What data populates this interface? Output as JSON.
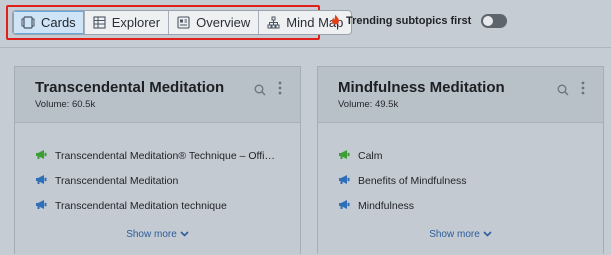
{
  "toolbar": {
    "tabs": [
      {
        "label": "Cards",
        "icon": "cards-icon",
        "active": true
      },
      {
        "label": "Explorer",
        "icon": "table-icon",
        "active": false
      },
      {
        "label": "Overview",
        "icon": "overview-icon",
        "active": false
      },
      {
        "label": "Mind Map",
        "icon": "mind-map-icon",
        "active": false
      }
    ],
    "trending_label": "Trending subtopics first",
    "trending_enabled": false
  },
  "colors": {
    "accent_border": "#e0211b",
    "active_tab_bg": "#cfe4f7",
    "link": "#2e5d9a",
    "megaphone_green": "#3e9e35",
    "megaphone_blue": "#2f6fb8"
  },
  "cards": [
    {
      "title": "Transcendental Meditation",
      "volume": "Volume: 60.5k",
      "items": [
        {
          "text": "Transcendental Meditation® Technique – Offi…",
          "icon": "megaphone-green-icon"
        },
        {
          "text": "Transcendental Meditation",
          "icon": "megaphone-blue-icon"
        },
        {
          "text": "Transcendental Meditation technique",
          "icon": "megaphone-blue-icon"
        }
      ],
      "show_more": "Show more"
    },
    {
      "title": "Mindfulness Meditation",
      "volume": "Volume: 49.5k",
      "items": [
        {
          "text": "Calm",
          "icon": "megaphone-green-icon"
        },
        {
          "text": "Benefits of Mindfulness",
          "icon": "megaphone-blue-icon"
        },
        {
          "text": "Mindfulness",
          "icon": "megaphone-blue-icon"
        }
      ],
      "show_more": "Show more"
    }
  ]
}
